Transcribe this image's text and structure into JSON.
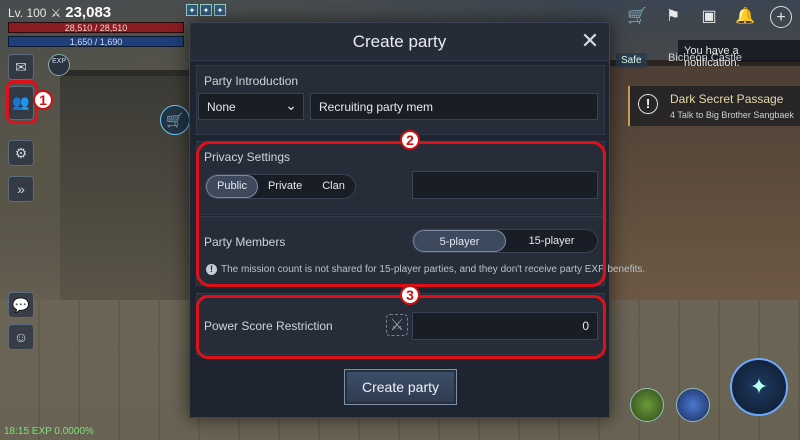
{
  "hud": {
    "level": "Lv. 100",
    "power": "23,083",
    "hp": "28,510 / 28,510",
    "mp": "1,650 / 1,690",
    "exp_badge": "EXP",
    "bottom_status": "18:15  EXP 0.0000%"
  },
  "notification": {
    "tooltip": "You have a notification."
  },
  "location": {
    "tag": "Safe",
    "name": "Bicheon Castle"
  },
  "quest": {
    "title": "Dark Secret Passage",
    "subtitle": "4 Talk to Big Brother Sangbaek"
  },
  "markers": [
    "1",
    "2",
    "3"
  ],
  "modal": {
    "title": "Create party",
    "close_symbol": "✕",
    "intro": {
      "label": "Party Introduction",
      "dropdown_value": "None",
      "text_value": "Recruiting party mem"
    },
    "privacy": {
      "label": "Privacy Settings",
      "options": [
        "Public",
        "Private",
        "Clan"
      ],
      "selected": "Public",
      "field_value": ""
    },
    "members": {
      "label": "Party Members",
      "options": [
        "5-player",
        "15-player"
      ],
      "selected": "5-player",
      "info": "The mission count is not shared for 15-player parties, and they don't receive party EXP benefits."
    },
    "power_restriction": {
      "label": "Power Score Restriction",
      "value": "0"
    },
    "create_button": "Create party"
  }
}
